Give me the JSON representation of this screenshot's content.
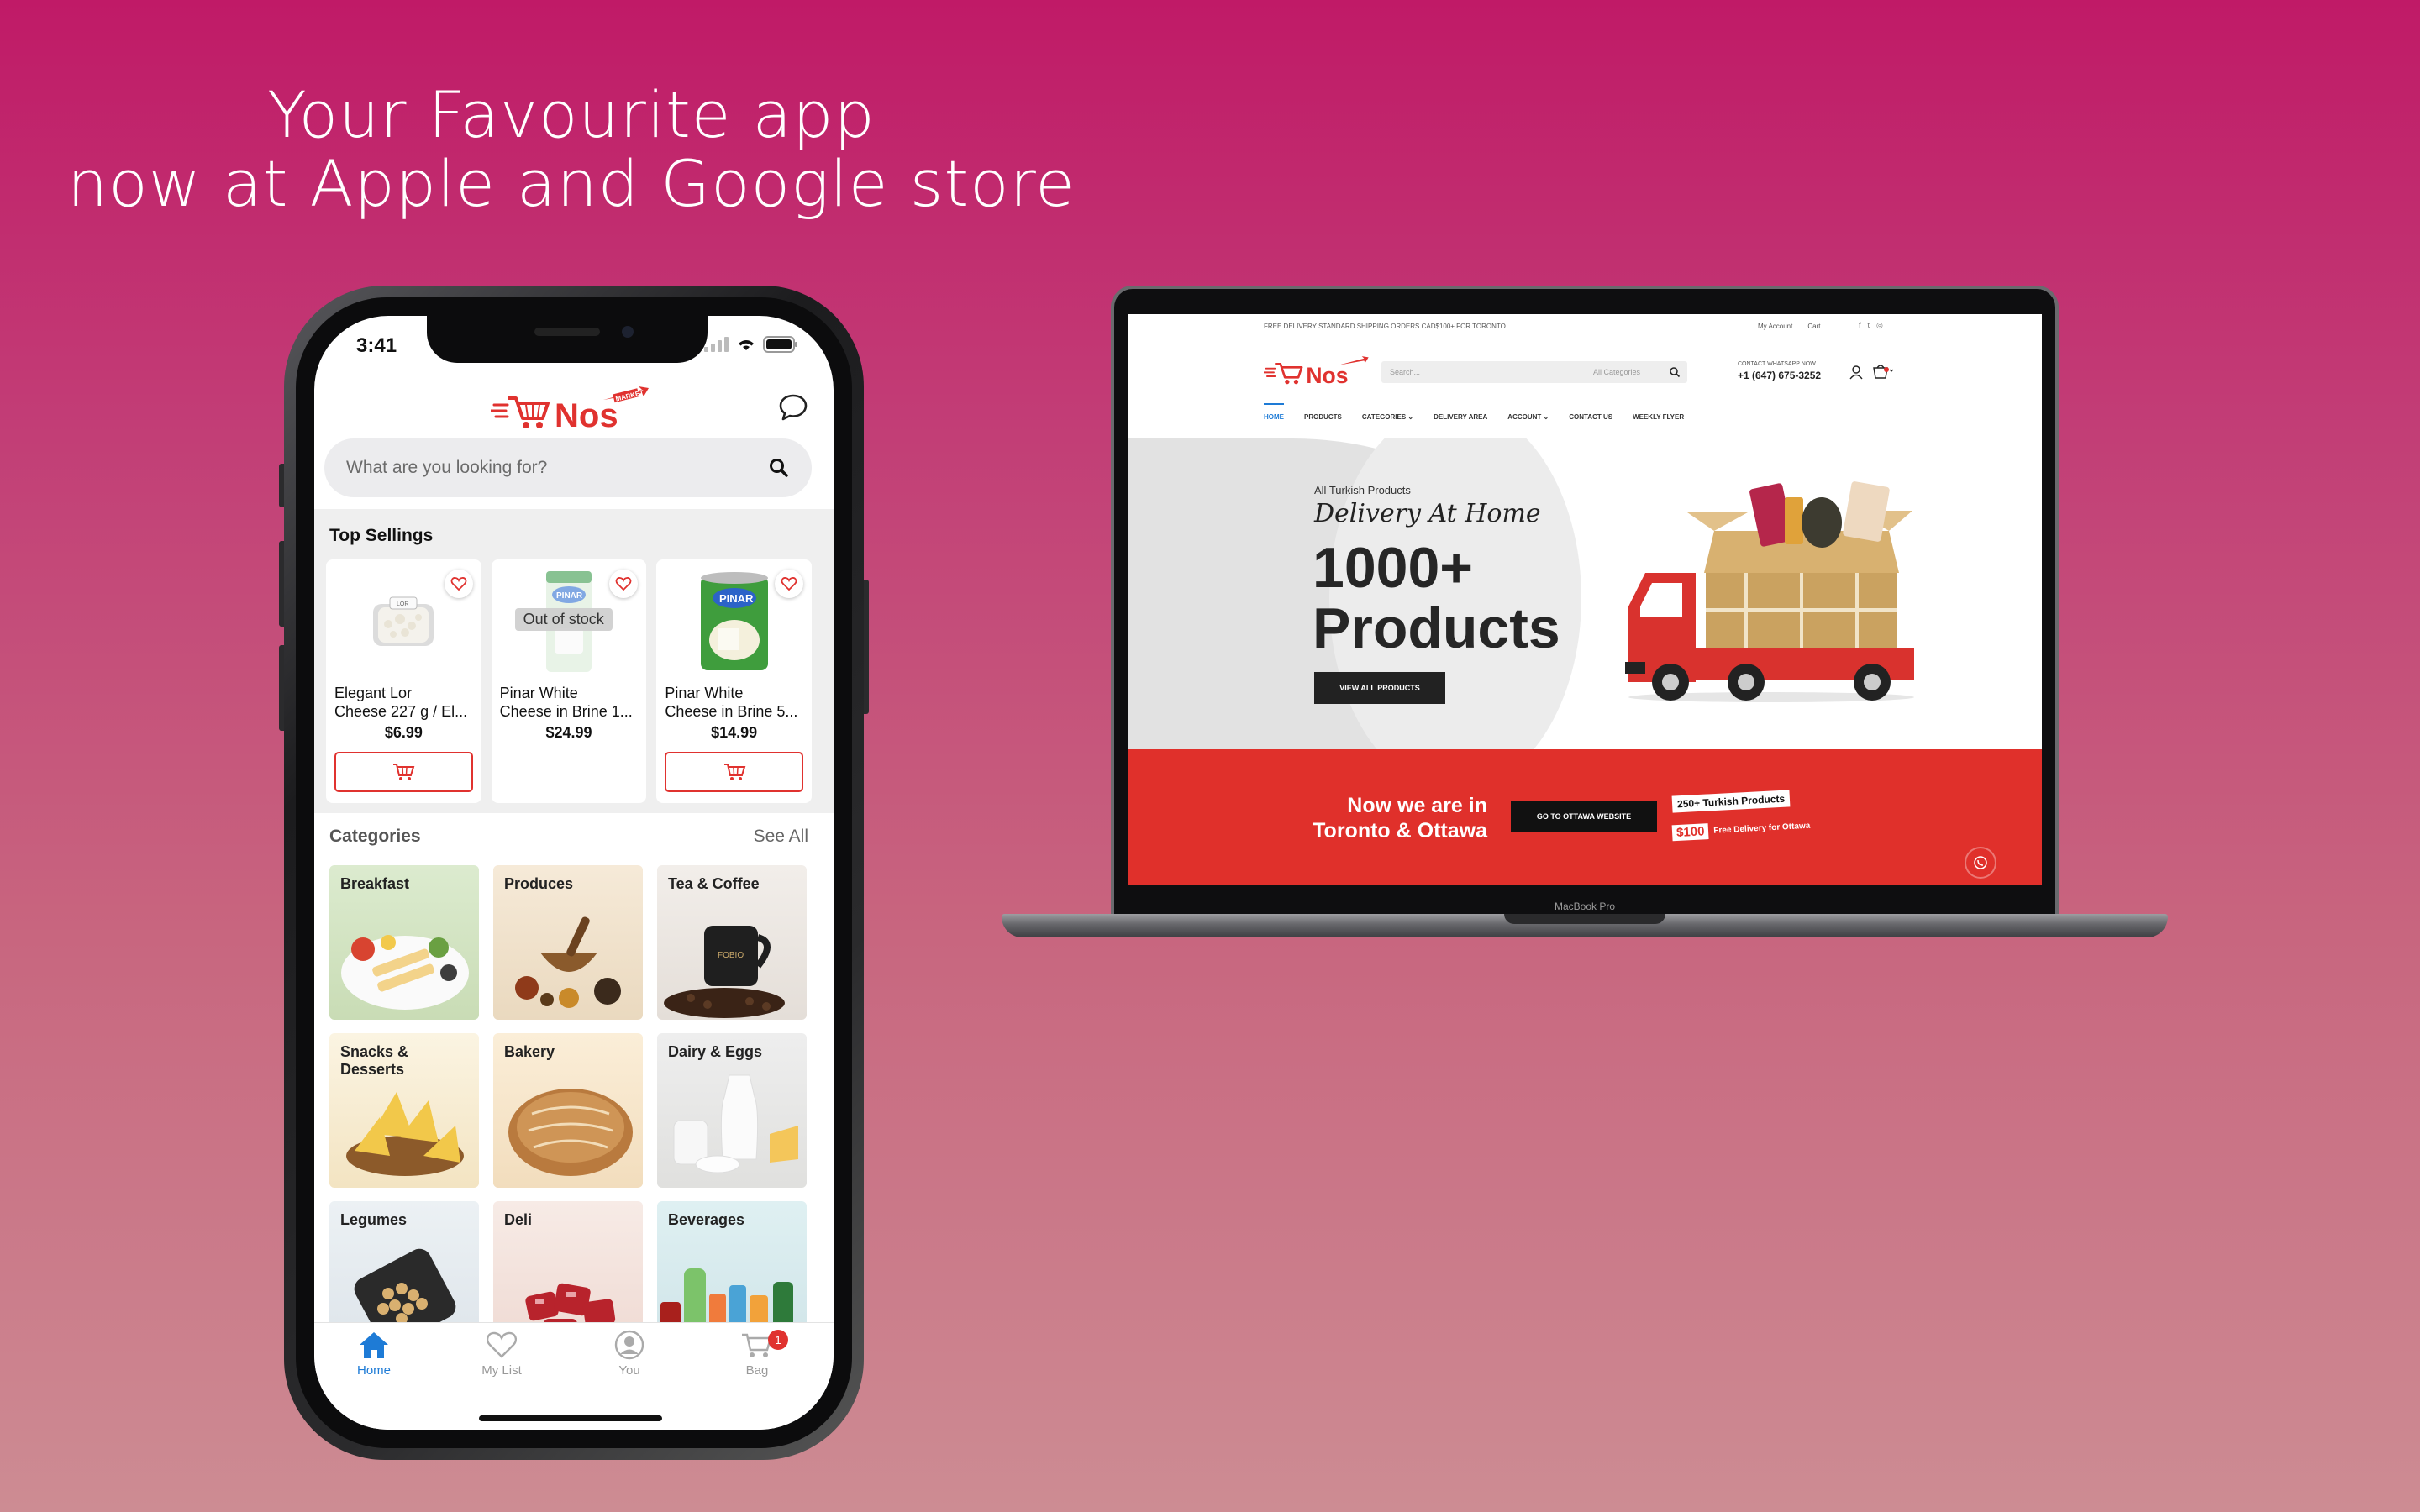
{
  "headline": {
    "line1": "Your Favourite app",
    "line2": "now at Apple and Google store"
  },
  "colors": {
    "brand_red": "#e0322f",
    "accent_blue": "#1e7bd6",
    "bg_top": "#c01a67",
    "bg_bottom": "#cd8c93"
  },
  "app": {
    "status_time": "3:41",
    "logo_alt": "Nos Market",
    "search_placeholder": "What are you looking for?",
    "top_sellings_title": "Top Sellings",
    "products": [
      {
        "name_line1": "Elegant Lor",
        "name_line2": "Cheese 227 g / El...",
        "price": "$6.99",
        "out_of_stock": ""
      },
      {
        "name_line1": "Pinar White",
        "name_line2": "Cheese in Brine 1...",
        "price": "$24.99",
        "out_of_stock": "Out of stock"
      },
      {
        "name_line1": "Pinar White",
        "name_line2": "Cheese in Brine 5...",
        "price": "$14.99",
        "out_of_stock": ""
      }
    ],
    "categories_title": "Categories",
    "see_all": "See All",
    "categories": [
      "Breakfast",
      "Produces",
      "Tea & Coffee",
      "Snacks & Desserts",
      "Bakery",
      "Dairy & Eggs",
      "Legumes",
      "Deli",
      "Beverages"
    ],
    "tabs": [
      {
        "label": "Home",
        "icon": "home-icon"
      },
      {
        "label": "My List",
        "icon": "heart-icon"
      },
      {
        "label": "You",
        "icon": "user-icon"
      },
      {
        "label": "Bag",
        "icon": "bag-icon",
        "badge": "1"
      }
    ]
  },
  "laptop": {
    "model_label": "MacBook Pro",
    "topbar_text": "FREE DELIVERY  STANDARD SHIPPING ORDERS CAD$100+ FOR TORONTO",
    "topbar_links": [
      "My Account",
      "Cart"
    ],
    "social": [
      "f",
      "t",
      "◎"
    ],
    "search_placeholder": "Search...",
    "search_category": "All Categories",
    "contact_label": "CONTACT WHATSAPP NOW",
    "contact_phone": "+1 (647) 675-3252",
    "nav": [
      "HOME",
      "PRODUCTS",
      "CATEGORIES ⌄",
      "DELIVERY AREA",
      "ACCOUNT ⌄",
      "CONTACT US",
      "WEEKLY FLYER"
    ],
    "hero_small": "All Turkish Products",
    "hero_script": "Delivery At Home",
    "hero_big_1": "1000+",
    "hero_big_2": "Products",
    "hero_button": "VIEW ALL PRODUCTS",
    "promo_heading_1": "Now we are in",
    "promo_heading_2": "Toronto & Ottawa",
    "promo_button": "GO TO OTTAWA WEBSITE",
    "promo_tag": "250+ Turkish Products",
    "promo_price": "$100",
    "promo_delivery": "Free Delivery for Ottawa"
  }
}
